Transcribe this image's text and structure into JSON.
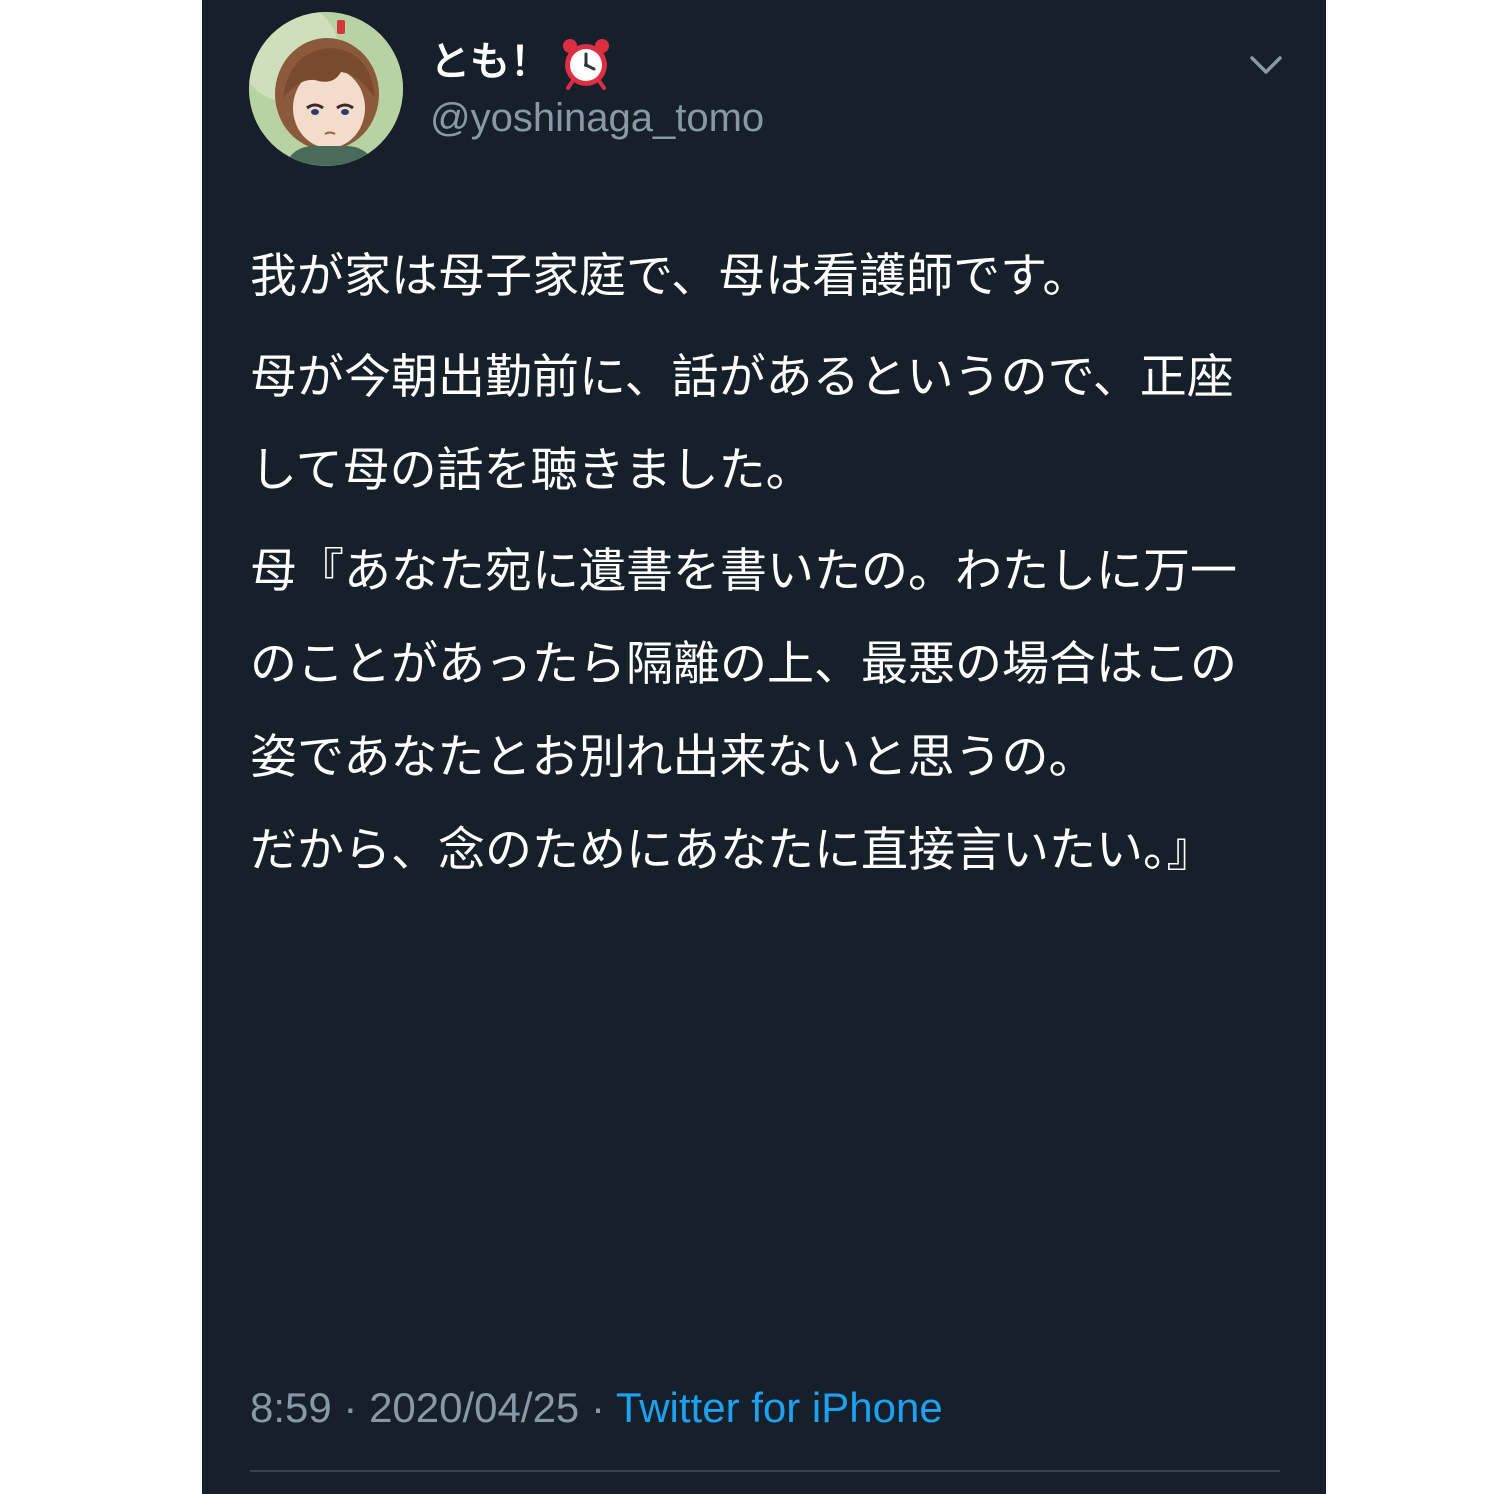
{
  "tweet": {
    "display_name": "とも！",
    "name_emoji": "alarm-clock",
    "handle": "@yoshinaga_tomo",
    "paragraphs": [
      "我が家は母子家庭で、母は看護師です。",
      "母が今朝出勤前に、話があるというので、正座して母の話を聴きました。",
      "母『あなた宛に遺書を書いたの。わたしに万一のことがあったら隔離の上、最悪の場合はこの姿であなたとお別れ出来ないと思うの。\nだから、念のためにあなたに直接言いたい。』"
    ],
    "time": "8:59",
    "separator": "·",
    "date": "2020/04/25",
    "source": "Twitter for iPhone"
  },
  "colors": {
    "background": "#15202b",
    "text": "#ffffff",
    "secondary_text": "#8899a6",
    "link": "#1da1f2",
    "divider": "#38444d"
  }
}
